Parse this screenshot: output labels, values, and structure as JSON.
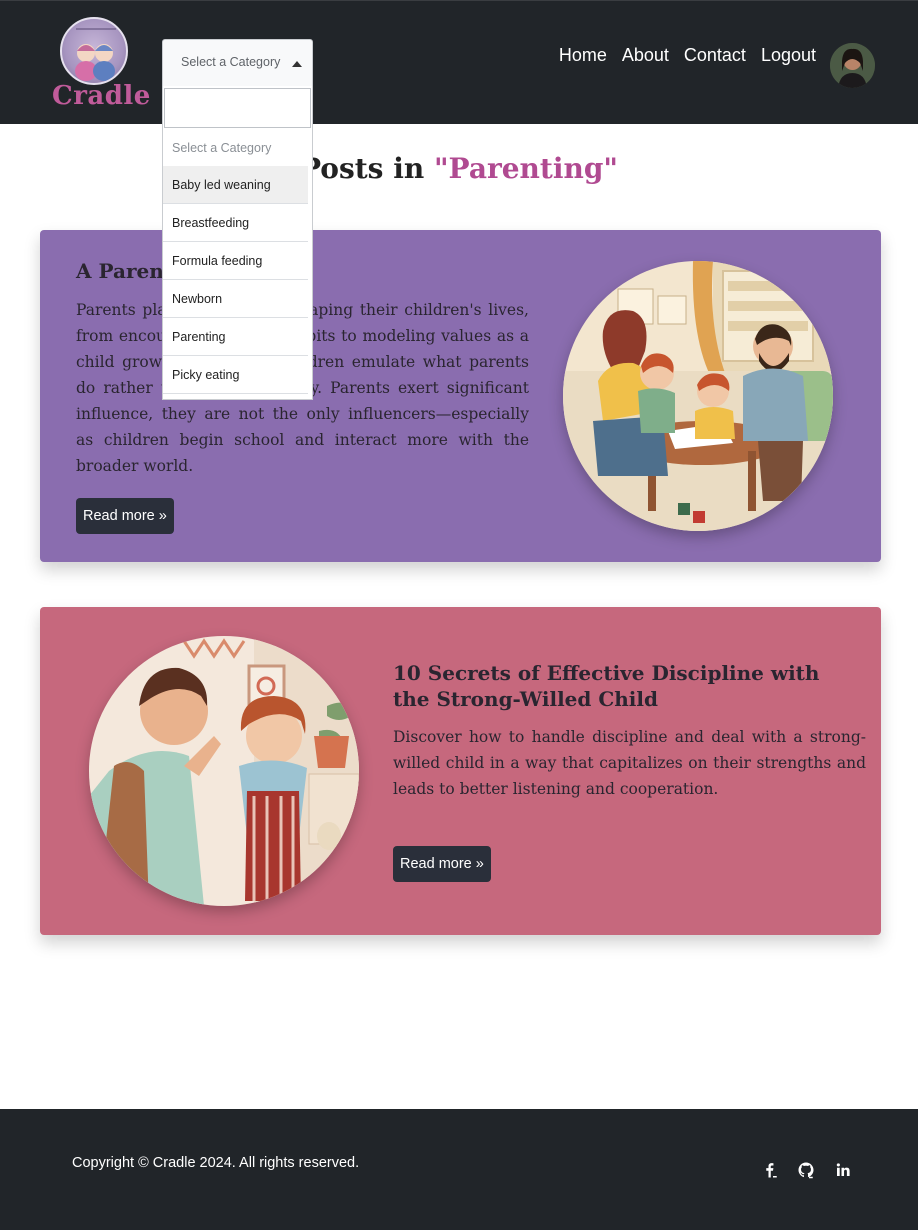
{
  "header": {
    "logo_text": "Cradle",
    "nav": [
      "Home",
      "About",
      "Contact",
      "Logout"
    ]
  },
  "category_select": {
    "selected": "Select a Category",
    "options": [
      "Select a Category",
      "Baby led weaning",
      "Breastfeeding",
      "Formula feeding",
      "Newborn",
      "Parenting",
      "Picky eating"
    ],
    "hovered": "Baby led weaning"
  },
  "page": {
    "title_prefix": "Posts in ",
    "title_category": "\"Parenting\""
  },
  "posts": [
    {
      "title": "A Parent’s",
      "body": "Parents play a key role in shaping their children's lives, from encouraging healthy habits to modeling values as a child grows. Remember, children emulate what parents do rather than what they say. Parents exert significant influence, they are not the only influencers—especially as children begin school and interact more with the broader world.",
      "button": "Read more »",
      "color": "#8a6daf"
    },
    {
      "title": "10 Secrets of Effective Discipline with the Strong-Willed Child",
      "body": "Discover how to handle discipline and deal with a strong-willed child in a way that capitalizes on their strengths and leads to better listening and cooperation.",
      "button": "Read more »",
      "color": "#c6687d"
    }
  ],
  "footer": {
    "copyright": "Copyright © Cradle 2024. All rights reserved.",
    "social_icons": [
      "facebook-icon",
      "github-icon",
      "linkedin-icon"
    ]
  }
}
